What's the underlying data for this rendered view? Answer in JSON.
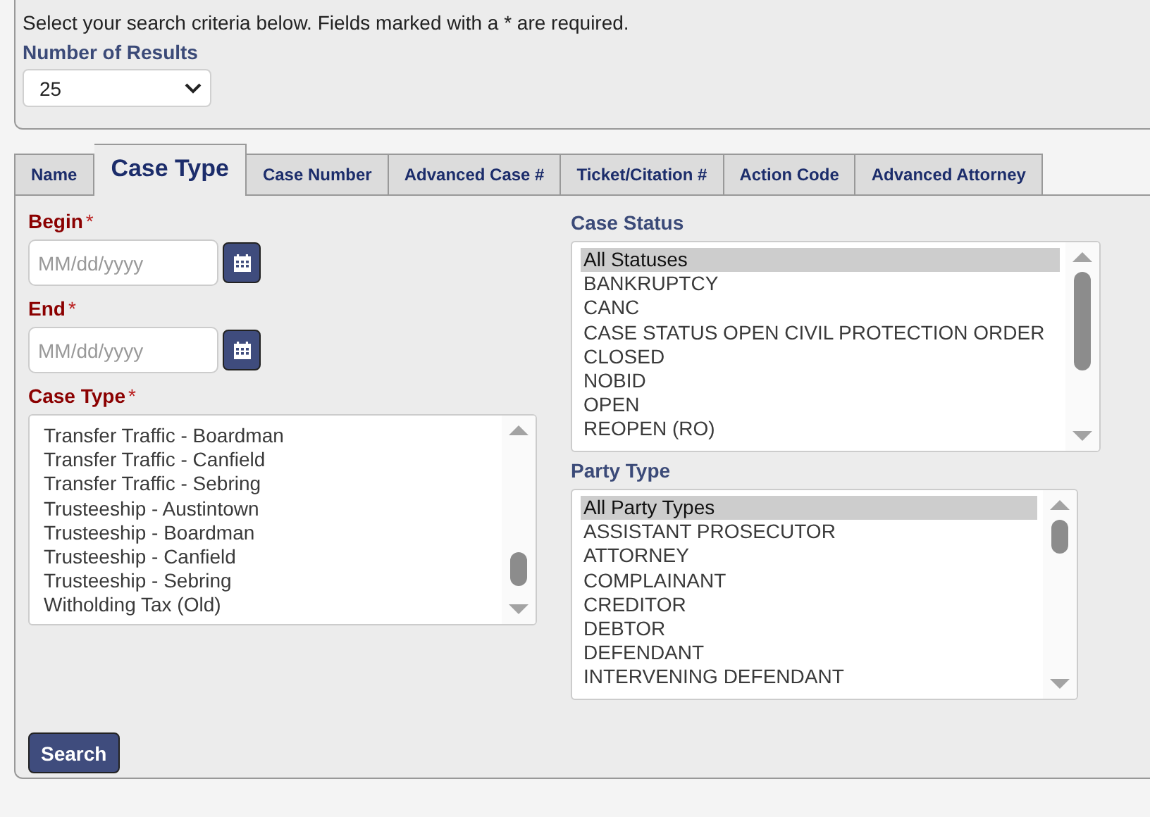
{
  "intro": {
    "text": "Select your search criteria below. Fields marked with a * are required.",
    "results_label": "Number of Results",
    "results_value": "25"
  },
  "tabs": [
    {
      "label": "Name",
      "selected": false
    },
    {
      "label": "Case Type",
      "selected": true
    },
    {
      "label": "Case Number",
      "selected": false
    },
    {
      "label": "Advanced Case #",
      "selected": false
    },
    {
      "label": "Ticket/Citation #",
      "selected": false
    },
    {
      "label": "Action Code",
      "selected": false
    },
    {
      "label": "Advanced Attorney",
      "selected": false
    }
  ],
  "begin": {
    "label": "Begin",
    "required": "*",
    "placeholder": "MM/dd/yyyy"
  },
  "end": {
    "label": "End",
    "required": "*",
    "placeholder": "MM/dd/yyyy"
  },
  "case_type": {
    "label": "Case Type",
    "required": "*",
    "items": [
      {
        "label": "Transfer Traffic - Boardman",
        "selected": false
      },
      {
        "label": "Transfer Traffic - Canfield",
        "selected": false
      },
      {
        "label": "Transfer Traffic - Sebring",
        "selected": false
      },
      {
        "label": "Trusteeship - Austintown",
        "selected": false
      },
      {
        "label": "Trusteeship - Boardman",
        "selected": false
      },
      {
        "label": "Trusteeship - Canfield",
        "selected": false
      },
      {
        "label": "Trusteeship - Sebring",
        "selected": false
      },
      {
        "label": "Witholding Tax (Old)",
        "selected": false
      }
    ]
  },
  "case_status": {
    "label": "Case Status",
    "items": [
      {
        "label": "All Statuses",
        "selected": true
      },
      {
        "label": "BANKRUPTCY",
        "selected": false
      },
      {
        "label": "CANC",
        "selected": false
      },
      {
        "label": "CASE STATUS OPEN CIVIL PROTECTION ORDER",
        "selected": false
      },
      {
        "label": "CLOSED",
        "selected": false
      },
      {
        "label": "NOBID",
        "selected": false
      },
      {
        "label": "OPEN",
        "selected": false
      },
      {
        "label": "REOPEN (RO)",
        "selected": false
      }
    ]
  },
  "party_type": {
    "label": "Party Type",
    "items": [
      {
        "label": "All Party Types",
        "selected": true
      },
      {
        "label": "ASSISTANT PROSECUTOR",
        "selected": false
      },
      {
        "label": "ATTORNEY",
        "selected": false
      },
      {
        "label": "COMPLAINANT",
        "selected": false
      },
      {
        "label": "CREDITOR",
        "selected": false
      },
      {
        "label": "DEBTOR",
        "selected": false
      },
      {
        "label": "DEFENDANT",
        "selected": false
      },
      {
        "label": "INTERVENING DEFENDANT",
        "selected": false
      }
    ]
  },
  "search_button": "Search"
}
